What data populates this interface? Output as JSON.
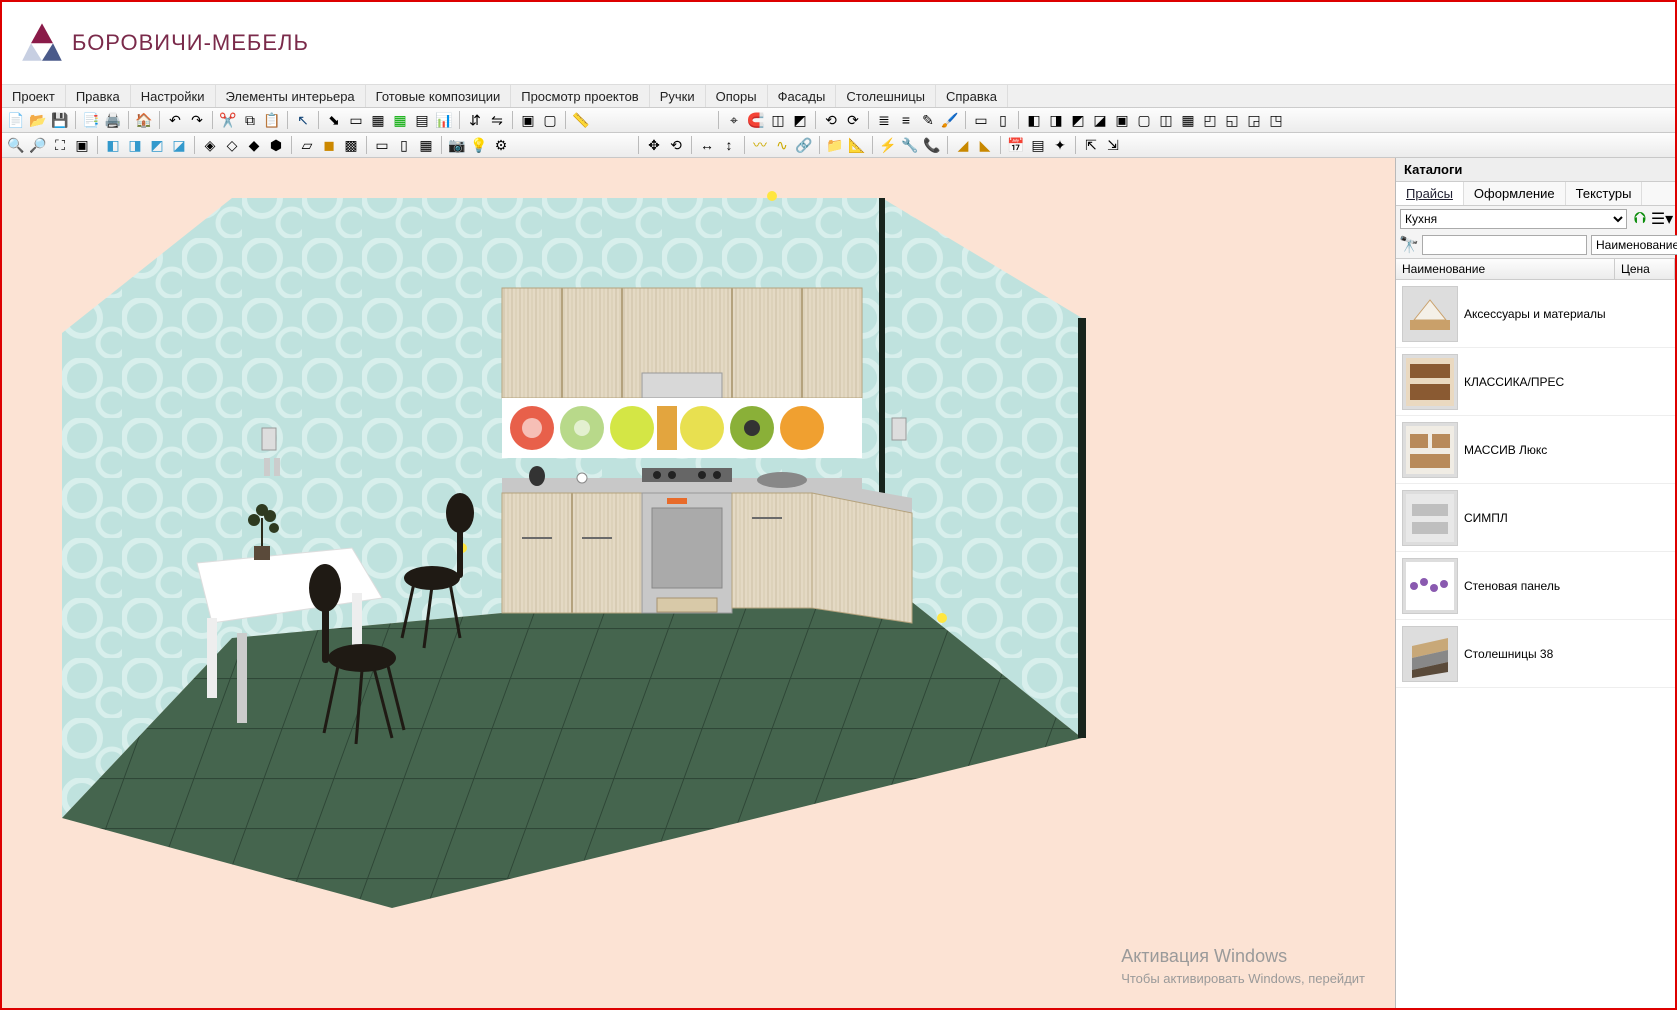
{
  "brand": "БОРОВИЧИ-МЕБЕЛЬ",
  "menu": {
    "project": "Проект",
    "edit": "Правка",
    "settings": "Настройки",
    "interior": "Элементы интерьера",
    "compositions": "Готовые композиции",
    "viewprojects": "Просмотр проектов",
    "handles": "Ручки",
    "supports": "Опоры",
    "facades": "Фасады",
    "worktops": "Столешницы",
    "help": "Справка"
  },
  "catalog": {
    "title": "Каталоги",
    "tabs": {
      "prices": "Прайсы",
      "design": "Оформление",
      "textures": "Текстуры"
    },
    "category": "Кухня",
    "search_placeholder": "",
    "search_mode": "Наименование",
    "cols": {
      "name": "Наименование",
      "price": "Цена"
    },
    "items": [
      {
        "name": "Аксессуары и материалы"
      },
      {
        "name": "КЛАССИКА/ПРЕС"
      },
      {
        "name": "МАССИВ Люкс"
      },
      {
        "name": "СИМПЛ"
      },
      {
        "name": "Стеновая панель"
      },
      {
        "name": "Столешницы 38"
      }
    ]
  },
  "watermark": {
    "line1": "Активация Windows",
    "line2": "Чтобы активировать Windows, перейдит"
  }
}
